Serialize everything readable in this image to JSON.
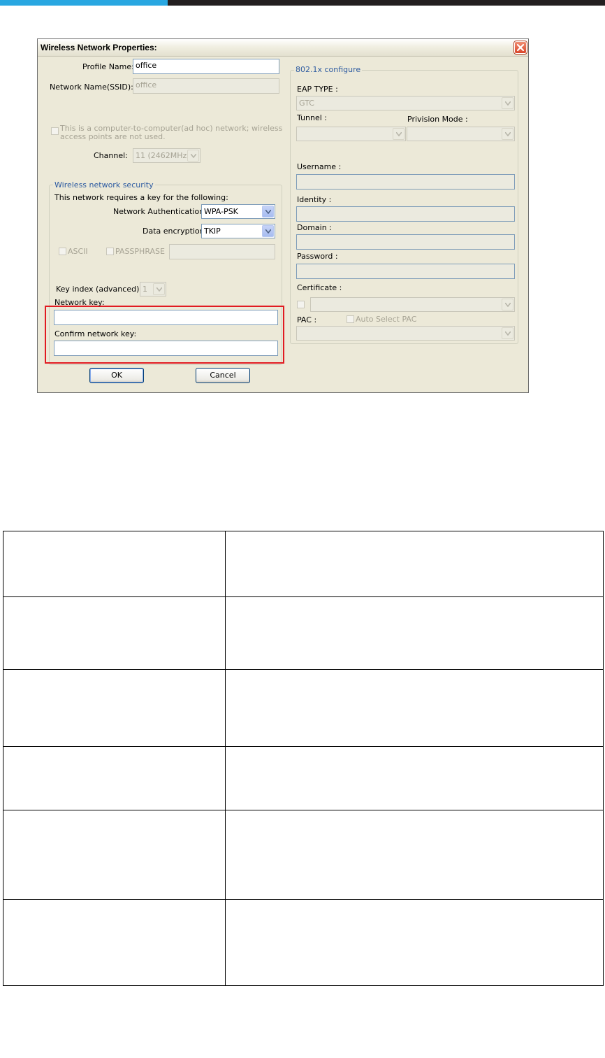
{
  "dialog": {
    "title": "Wireless Network Properties:",
    "profile_name_label": "Profile Name:",
    "profile_name_value": "office",
    "ssid_label": "Network Name(SSID):",
    "ssid_value": "office",
    "adhoc_label_line1": "This is a computer-to-computer(ad hoc) network; wireless",
    "adhoc_label_line2": "access points are not used.",
    "channel_label": "Channel:",
    "channel_value": "11 (2462MHz)",
    "security": {
      "group_title": "Wireless network security",
      "intro": "This network requires a key for the following:",
      "auth_label": "Network Authentication:",
      "auth_value": "WPA-PSK",
      "encryption_label": "Data encryption:",
      "encryption_value": "TKIP",
      "ascii_label": "ASCII",
      "passphrase_label": "PASSPHRASE",
      "key_index_label": "Key index (advanced):",
      "key_index_value": "1",
      "network_key_label": "Network key:",
      "network_key_value": "",
      "confirm_key_label": "Confirm network key:",
      "confirm_key_value": ""
    },
    "eap": {
      "group_title": "802.1x configure",
      "eap_type_label": "EAP TYPE :",
      "eap_type_value": "GTC",
      "tunnel_label": "Tunnel :",
      "provision_label": "Privision Mode :",
      "username_label": "Username :",
      "identity_label": "Identity :",
      "domain_label": "Domain :",
      "password_label": "Password :",
      "certificate_label": "Certificate :",
      "pac_label": "PAC :",
      "auto_pac_label": "Auto Select PAC"
    },
    "ok_label": "OK",
    "cancel_label": "Cancel",
    "colors": {
      "highlight": "#e11b22",
      "accent_blue": "#29a7e1",
      "group_title_blue": "#2c5aa0"
    }
  },
  "description_table": {
    "rows": [
      {
        "label": "",
        "text": ""
      },
      {
        "label": "",
        "text": ""
      },
      {
        "label": "",
        "text": ""
      },
      {
        "label": "",
        "text": ""
      },
      {
        "label": "",
        "text": ""
      },
      {
        "label": "",
        "text": ""
      }
    ]
  }
}
